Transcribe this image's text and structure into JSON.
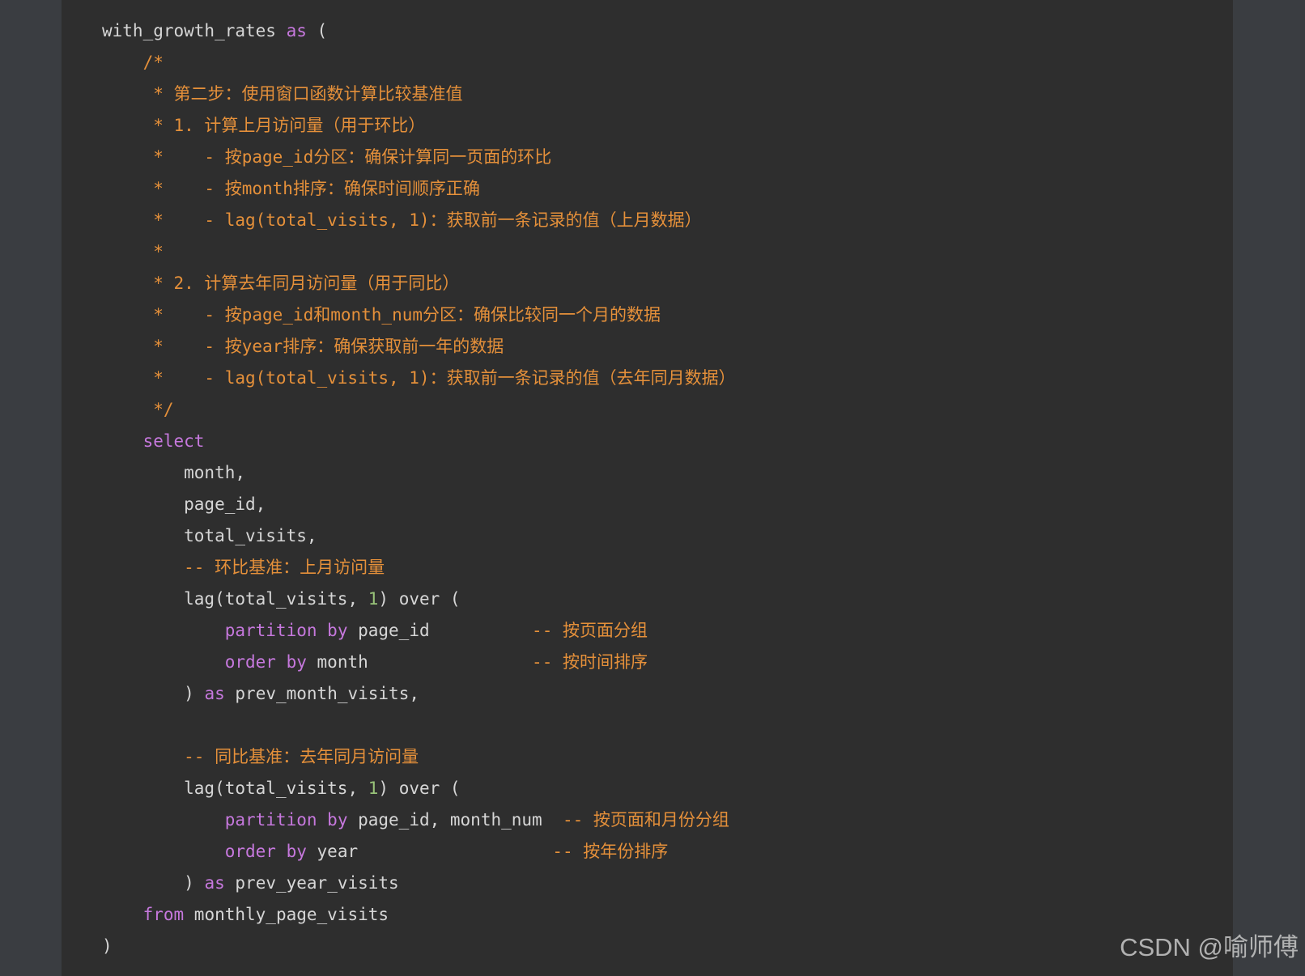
{
  "code": {
    "lines": [
      [
        {
          "t": "with_growth_rates ",
          "c": "id"
        },
        {
          "t": "as",
          "c": "kw"
        },
        {
          "t": " (",
          "c": "pn"
        }
      ],
      [
        {
          "t": "    /*",
          "c": "cm"
        }
      ],
      [
        {
          "t": "     * 第二步：使用窗口函数计算比较基准值",
          "c": "cm"
        }
      ],
      [
        {
          "t": "     * 1. 计算上月访问量（用于环比）",
          "c": "cm"
        }
      ],
      [
        {
          "t": "     *    - 按page_id分区：确保计算同一页面的环比",
          "c": "cm"
        }
      ],
      [
        {
          "t": "     *    - 按month排序：确保时间顺序正确",
          "c": "cm"
        }
      ],
      [
        {
          "t": "     *    - lag(total_visits, 1)：获取前一条记录的值（上月数据）",
          "c": "cm"
        }
      ],
      [
        {
          "t": "     *",
          "c": "cm"
        }
      ],
      [
        {
          "t": "     * 2. 计算去年同月访问量（用于同比）",
          "c": "cm"
        }
      ],
      [
        {
          "t": "     *    - 按page_id和month_num分区：确保比较同一个月的数据",
          "c": "cm"
        }
      ],
      [
        {
          "t": "     *    - 按year排序：确保获取前一年的数据",
          "c": "cm"
        }
      ],
      [
        {
          "t": "     *    - lag(total_visits, 1)：获取前一条记录的值（去年同月数据）",
          "c": "cm"
        }
      ],
      [
        {
          "t": "     */",
          "c": "cm"
        }
      ],
      [
        {
          "t": "    ",
          "c": "id"
        },
        {
          "t": "select",
          "c": "kw"
        }
      ],
      [
        {
          "t": "        month,",
          "c": "id"
        }
      ],
      [
        {
          "t": "        page_id,",
          "c": "id"
        }
      ],
      [
        {
          "t": "        total_visits,",
          "c": "id"
        }
      ],
      [
        {
          "t": "        -- 环比基准：上月访问量",
          "c": "cm"
        }
      ],
      [
        {
          "t": "        lag",
          "c": "id"
        },
        {
          "t": "(",
          "c": "pn"
        },
        {
          "t": "total_visits, ",
          "c": "id"
        },
        {
          "t": "1",
          "c": "num"
        },
        {
          "t": ")",
          "c": "pn"
        },
        {
          "t": " over ",
          "c": "id"
        },
        {
          "t": "(",
          "c": "pn"
        }
      ],
      [
        {
          "t": "            ",
          "c": "id"
        },
        {
          "t": "partition",
          "c": "kw"
        },
        {
          "t": " ",
          "c": "id"
        },
        {
          "t": "by",
          "c": "kw"
        },
        {
          "t": " page_id          ",
          "c": "id"
        },
        {
          "t": "-- 按页面分组",
          "c": "cm"
        }
      ],
      [
        {
          "t": "            ",
          "c": "id"
        },
        {
          "t": "order",
          "c": "kw"
        },
        {
          "t": " ",
          "c": "id"
        },
        {
          "t": "by",
          "c": "kw"
        },
        {
          "t": " month                ",
          "c": "id"
        },
        {
          "t": "-- 按时间排序",
          "c": "cm"
        }
      ],
      [
        {
          "t": "        ",
          "c": "id"
        },
        {
          "t": ")",
          "c": "pn"
        },
        {
          "t": " ",
          "c": "id"
        },
        {
          "t": "as",
          "c": "kw"
        },
        {
          "t": " prev_month_visits,",
          "c": "id"
        }
      ],
      [
        {
          "t": "",
          "c": "id"
        }
      ],
      [
        {
          "t": "        -- 同比基准：去年同月访问量",
          "c": "cm"
        }
      ],
      [
        {
          "t": "        lag",
          "c": "id"
        },
        {
          "t": "(",
          "c": "pn"
        },
        {
          "t": "total_visits, ",
          "c": "id"
        },
        {
          "t": "1",
          "c": "num"
        },
        {
          "t": ")",
          "c": "pn"
        },
        {
          "t": " over ",
          "c": "id"
        },
        {
          "t": "(",
          "c": "pn"
        }
      ],
      [
        {
          "t": "            ",
          "c": "id"
        },
        {
          "t": "partition",
          "c": "kw"
        },
        {
          "t": " ",
          "c": "id"
        },
        {
          "t": "by",
          "c": "kw"
        },
        {
          "t": " page_id, month_num  ",
          "c": "id"
        },
        {
          "t": "-- 按页面和月份分组",
          "c": "cm"
        }
      ],
      [
        {
          "t": "            ",
          "c": "id"
        },
        {
          "t": "order",
          "c": "kw"
        },
        {
          "t": " ",
          "c": "id"
        },
        {
          "t": "by",
          "c": "kw"
        },
        {
          "t": " year                   ",
          "c": "id"
        },
        {
          "t": "-- 按年份排序",
          "c": "cm"
        }
      ],
      [
        {
          "t": "        ",
          "c": "id"
        },
        {
          "t": ")",
          "c": "pn"
        },
        {
          "t": " ",
          "c": "id"
        },
        {
          "t": "as",
          "c": "kw"
        },
        {
          "t": " prev_year_visits",
          "c": "id"
        }
      ],
      [
        {
          "t": "    ",
          "c": "id"
        },
        {
          "t": "from",
          "c": "kw"
        },
        {
          "t": " monthly_page_visits",
          "c": "id"
        }
      ],
      [
        {
          "t": ")",
          "c": "pn"
        }
      ]
    ]
  },
  "watermark": {
    "text": "CSDN @喻师傅"
  },
  "colors": {
    "background": "#3a3d41",
    "code_background": "#2e2e2e",
    "identifier": "#d6d6d6",
    "keyword": "#c678dd",
    "comment": "#e5903a",
    "number": "#98c379"
  }
}
